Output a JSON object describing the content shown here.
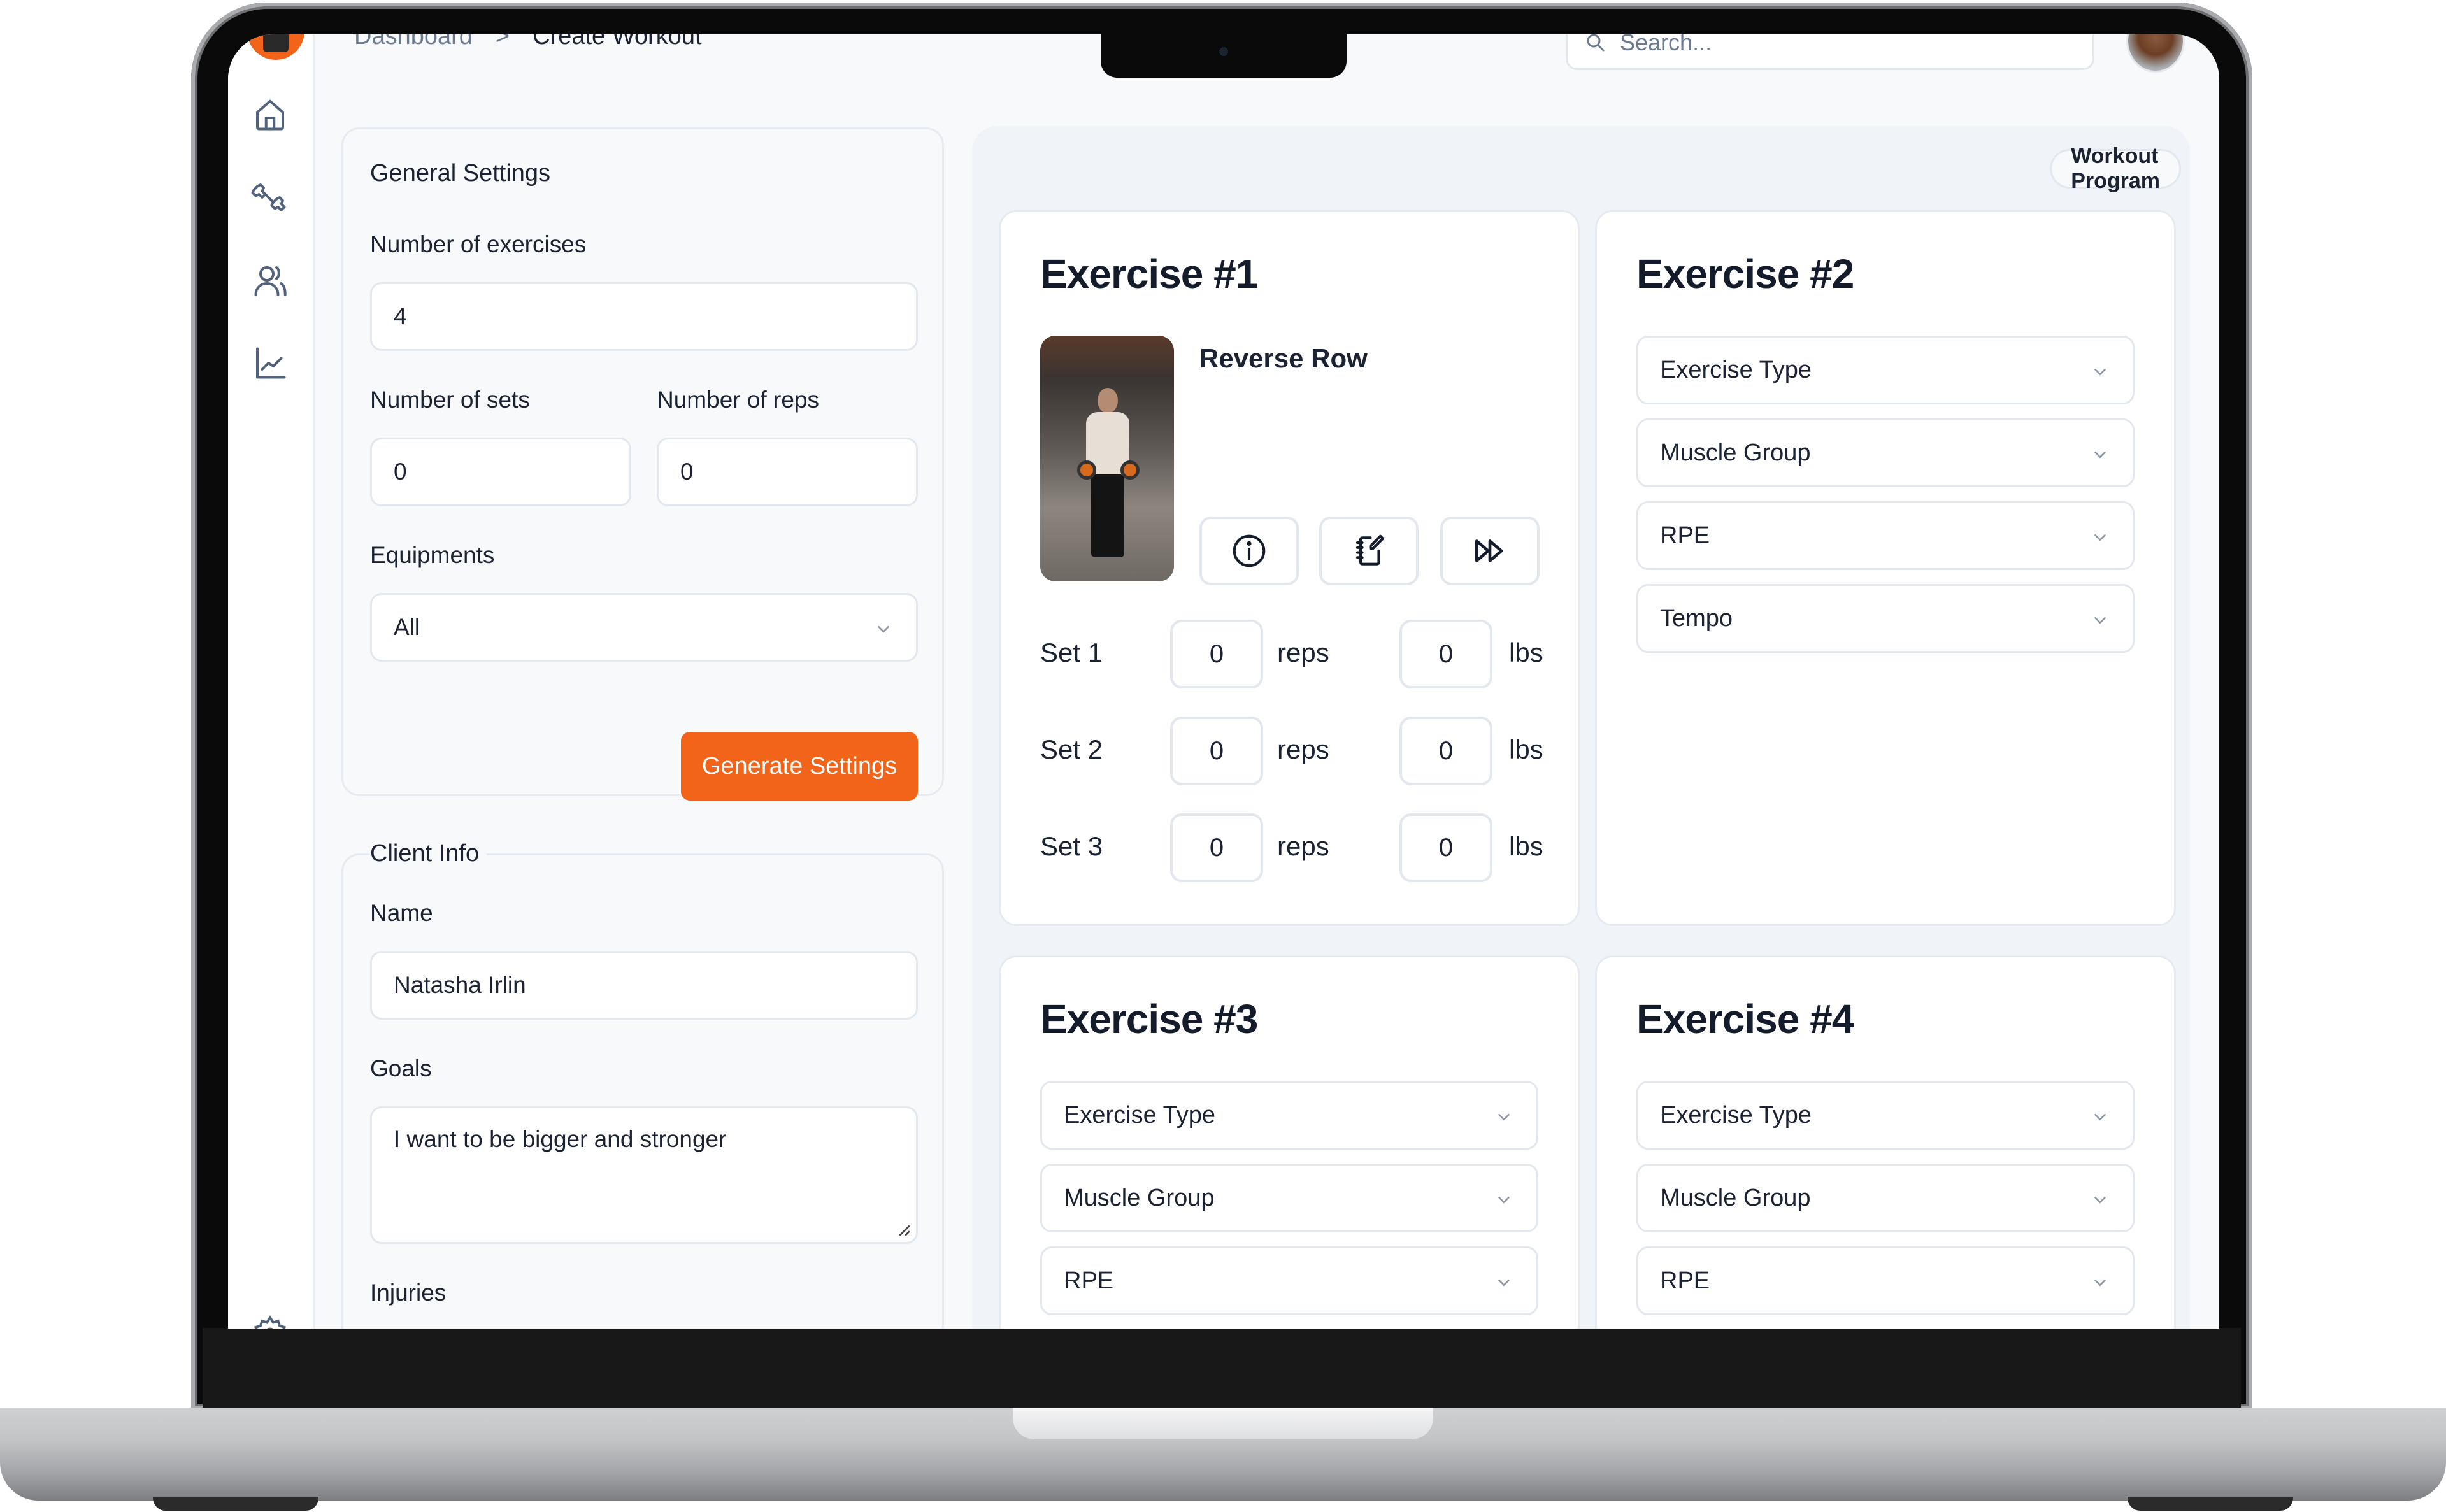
{
  "breadcrumb": {
    "items": [
      "Dashboard",
      "Create Workout"
    ],
    "separator": ">"
  },
  "search": {
    "placeholder": "Search..."
  },
  "sidebar": {
    "items": [
      {
        "name": "home",
        "icon": "home-icon"
      },
      {
        "name": "workouts",
        "icon": "dumbbell-icon"
      },
      {
        "name": "clients",
        "icon": "users-icon"
      },
      {
        "name": "analytics",
        "icon": "chart-icon"
      },
      {
        "name": "settings",
        "icon": "settings-icon"
      }
    ]
  },
  "general_settings": {
    "title": "General Settings",
    "num_exercises_label": "Number of exercises",
    "num_exercises_value": "4",
    "num_sets_label": "Number of sets",
    "num_sets_value": "0",
    "num_reps_label": "Number of reps",
    "num_reps_value": "0",
    "equipments_label": "Equipments",
    "equipments_value": "All",
    "generate_button": "Generate Settings"
  },
  "client_info": {
    "title": "Client Info",
    "name_label": "Name",
    "name_value": "Natasha Irlin",
    "goals_label": "Goals",
    "goals_value": "I want to be bigger and stronger",
    "injuries_label": "Injuries"
  },
  "program": {
    "badge": "Workout Program",
    "exercises": [
      {
        "title": "Exercise #1",
        "name": "Reverse Row",
        "actions": [
          "info-icon",
          "notebook-edit-icon",
          "fast-forward-icon"
        ],
        "sets": [
          {
            "label": "Set 1",
            "reps": "0",
            "reps_unit": "reps",
            "weight": "0",
            "weight_unit": "lbs"
          },
          {
            "label": "Set 2",
            "reps": "0",
            "reps_unit": "reps",
            "weight": "0",
            "weight_unit": "lbs"
          },
          {
            "label": "Set 3",
            "reps": "0",
            "reps_unit": "reps",
            "weight": "0",
            "weight_unit": "lbs"
          }
        ]
      },
      {
        "title": "Exercise #2",
        "dropdowns": [
          "Exercise Type",
          "Muscle Group",
          "RPE",
          "Tempo"
        ]
      },
      {
        "title": "Exercise #3",
        "dropdowns": [
          "Exercise Type",
          "Muscle Group",
          "RPE"
        ]
      },
      {
        "title": "Exercise #4",
        "dropdowns": [
          "Exercise Type",
          "Muscle Group",
          "RPE"
        ]
      }
    ]
  },
  "colors": {
    "accent": "#f26419",
    "text": "#1b2333",
    "muted": "#6b7a90",
    "border": "#e3e8ef",
    "background": "#f7f9fb"
  }
}
